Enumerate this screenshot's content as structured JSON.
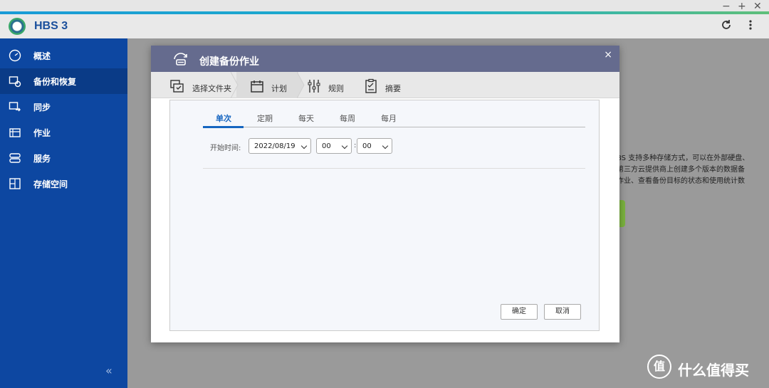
{
  "window": {
    "minimize": "−",
    "maximize": "+",
    "close": "✕"
  },
  "header": {
    "app_title": "HBS 3",
    "refresh_icon": "refresh-icon",
    "more_icon": "more-vertical-icon"
  },
  "sidebar": {
    "items": [
      {
        "label": "概述",
        "icon": "gauge-icon"
      },
      {
        "label": "备份和恢复",
        "icon": "backup-restore-icon",
        "active": true
      },
      {
        "label": "同步",
        "icon": "sync-icon"
      },
      {
        "label": "作业",
        "icon": "job-icon"
      },
      {
        "label": "服务",
        "icon": "service-icon"
      },
      {
        "label": "存储空间",
        "icon": "storage-icon"
      }
    ],
    "collapse": "«"
  },
  "background": {
    "line1": "BS 支持多种存储方式，可以在外部硬盘、",
    "line2": "第三方云提供商上创建多个版本的数据备",
    "line3": "作业、查看备份目标的状态和使用统计数"
  },
  "dialog": {
    "title": "创建备份作业",
    "close": "×",
    "steps": [
      {
        "label": "选择文件夹",
        "icon": "folders-icon"
      },
      {
        "label": "计划",
        "icon": "calendar-icon",
        "active": true
      },
      {
        "label": "规则",
        "icon": "sliders-icon"
      },
      {
        "label": "摘要",
        "icon": "clipboard-icon"
      }
    ]
  },
  "schedule": {
    "tabs": [
      "单次",
      "定期",
      "每天",
      "每周",
      "每月"
    ],
    "active_tab": "单次",
    "start_label": "开始时间:",
    "date": "2022/08/19",
    "hour": "00",
    "minute": "00",
    "colon": ":",
    "ok": "确定",
    "cancel": "取消"
  },
  "watermark": {
    "logo": "值",
    "text": "什么值得买"
  },
  "colors": {
    "sidebar": "#0d47a1",
    "dialog_header": "#656b8e",
    "accent": "#1565c0"
  }
}
